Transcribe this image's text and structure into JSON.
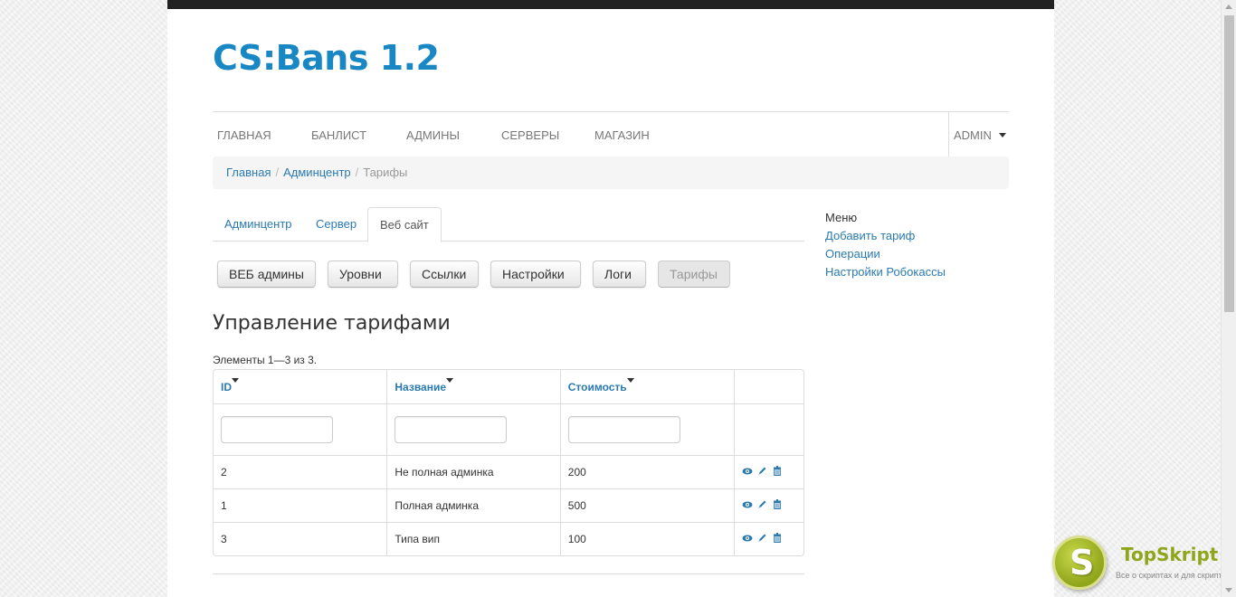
{
  "brand": "CS:Bans 1.2",
  "nav": {
    "items": [
      "ГЛАВНАЯ",
      "БАНЛИСТ",
      "АДМИНЫ",
      "СЕРВЕРЫ",
      "МАГАЗИН"
    ],
    "admin": "ADMIN"
  },
  "breadcrumb": {
    "home": "Главная",
    "admincenter": "Админцентр",
    "current": "Тарифы",
    "separator": "/"
  },
  "tabs": [
    "Админцентр",
    "Сервер",
    "Веб сайт"
  ],
  "buttons": [
    "ВЕБ админы",
    "Уровни",
    "Ссылки",
    "Настройки",
    "Логи",
    "Тарифы"
  ],
  "page_title": "Управление тарифами",
  "summary": "Элементы 1—3 из 3.",
  "table": {
    "columns": [
      "ID",
      "Название",
      "Стоимость"
    ],
    "rows": [
      {
        "id": "2",
        "name": "Не полная админка",
        "price": "200"
      },
      {
        "id": "1",
        "name": "Полная админка",
        "price": "500"
      },
      {
        "id": "3",
        "name": "Типа вип",
        "price": "100"
      }
    ],
    "action_icons": [
      "view-icon",
      "edit-icon",
      "delete-icon"
    ]
  },
  "sidebar": {
    "header": "Меню",
    "links": [
      "Добавить тариф",
      "Операции",
      "Настройки Робокассы"
    ]
  },
  "watermark": {
    "letter": "S",
    "name": "TopSkript",
    "tagline": "Все о скриптах и для скриптов..."
  },
  "colors": {
    "brand": "#1a87c5",
    "link": "#2a7ab0",
    "topbar": "#222222",
    "watermark_green": "#8fa51a"
  }
}
